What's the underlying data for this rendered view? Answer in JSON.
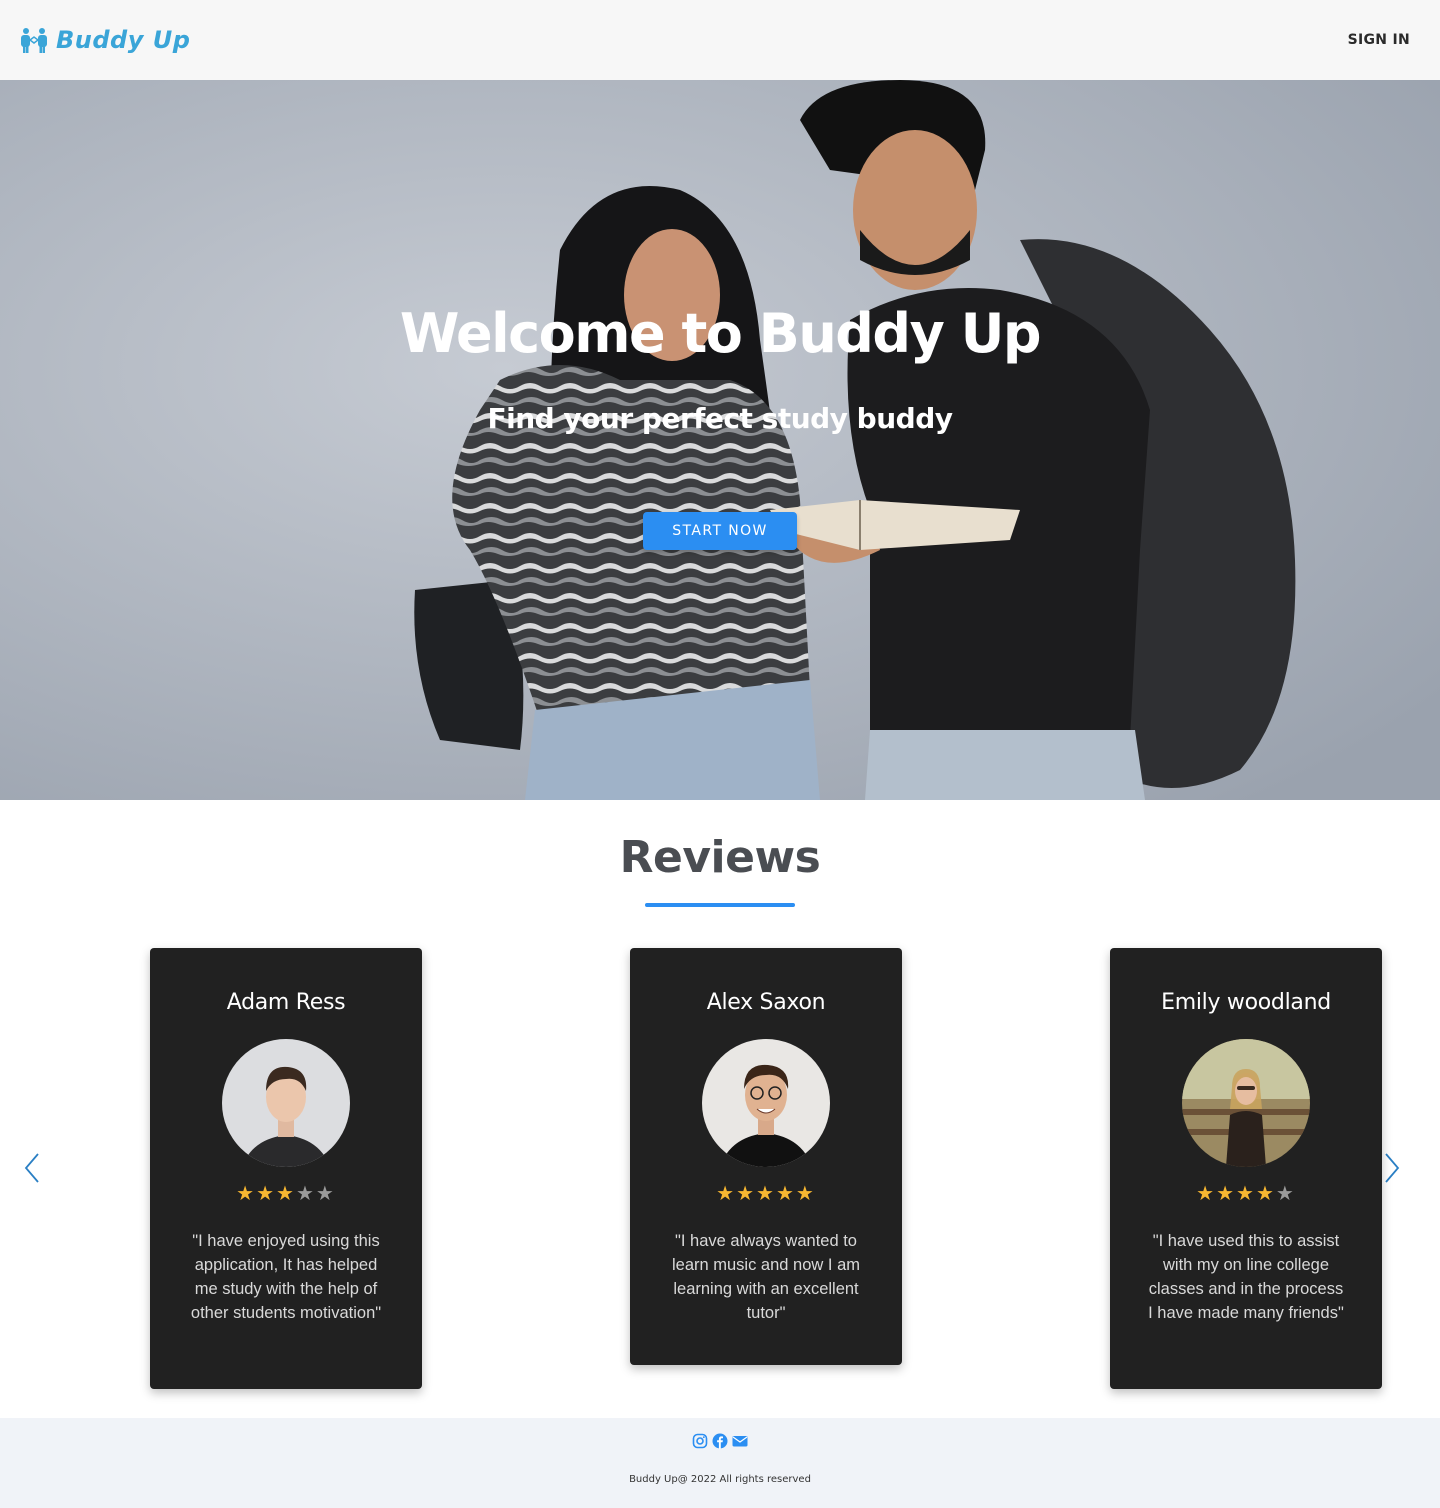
{
  "header": {
    "brand_name": "Buddy Up",
    "sign_in_label": "SIGN IN"
  },
  "hero": {
    "title": "Welcome to Buddy Up",
    "subtitle": "Find your perfect study buddy",
    "cta_label": "START NOW"
  },
  "reviews": {
    "title": "Reviews",
    "items": [
      {
        "name": "Adam Ress",
        "rating": 3,
        "max_rating": 5,
        "text": "\"I have enjoyed using this application, It has helped me study with the help of other students motivation\""
      },
      {
        "name": "Alex Saxon",
        "rating": 5,
        "max_rating": 5,
        "text": "\"I have always wanted to learn music and now I am learning with an excellent tutor\""
      },
      {
        "name": "Emily woodland",
        "rating": 4,
        "max_rating": 5,
        "text": "\"I have used this to assist with my on line college classes and in the process I have made many friends\""
      }
    ]
  },
  "footer": {
    "social_icons": [
      "instagram-icon",
      "facebook-icon",
      "mail-icon"
    ],
    "copyright": "Buddy Up@ 2022 All rights reserved"
  },
  "colors": {
    "brand": "#3aa5d8",
    "accent": "#2b8ef2",
    "card_bg": "#212121",
    "star_on": "#f7b731",
    "star_off": "#9a9a9a"
  }
}
